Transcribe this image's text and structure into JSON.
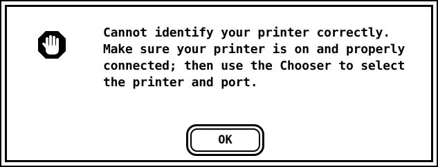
{
  "dialog": {
    "icon": "stop-hand-icon",
    "message_lines": [
      "Cannot identify your printer correctly.",
      "Make sure your printer is on and properly",
      "connected; then use the Chooser to select",
      "the printer and port."
    ],
    "ok_label": "OK"
  },
  "colors": {
    "foreground": "#000000",
    "background": "#ffffff"
  }
}
